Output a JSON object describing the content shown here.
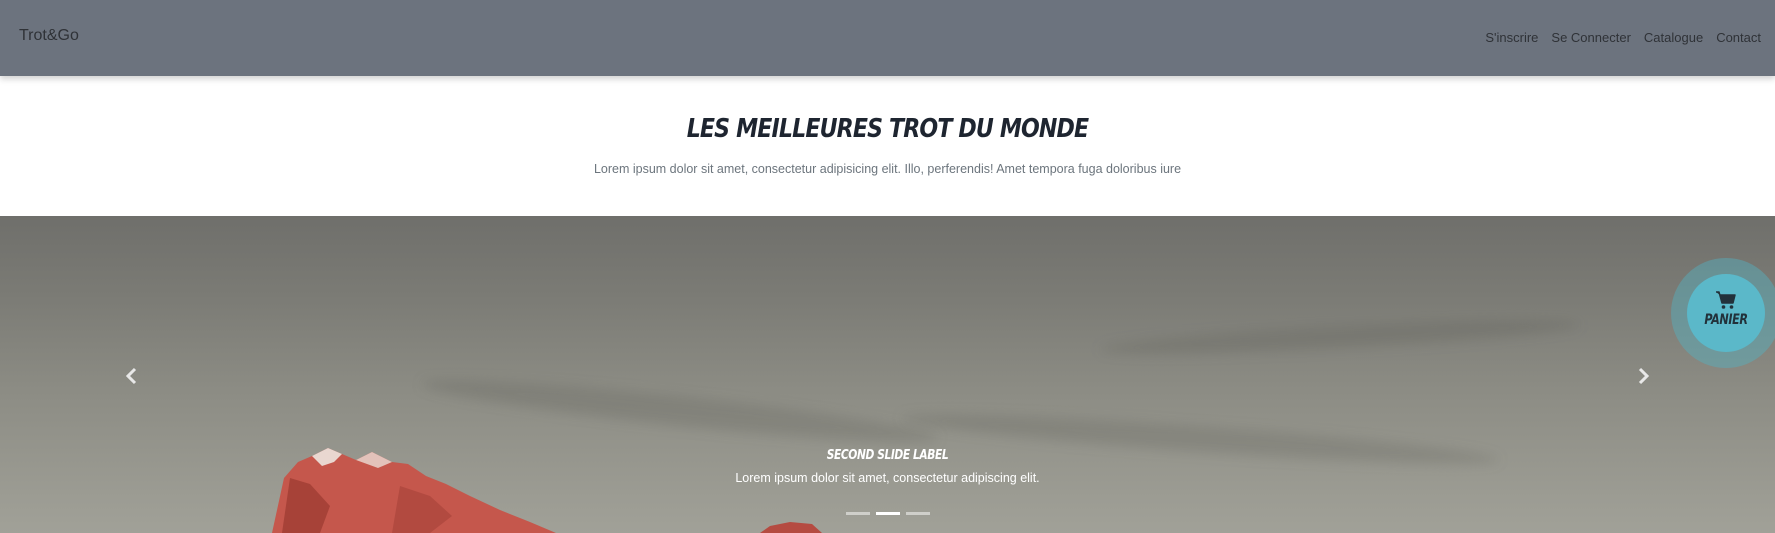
{
  "navbar": {
    "brand": "Trot&Go",
    "links": [
      "S'inscrire",
      "Se Connecter",
      "Catalogue",
      "Contact"
    ]
  },
  "hero": {
    "title": "Les meilleures trot du monde",
    "subtitle": "Lorem ipsum dolor sit amet, consectetur adipisicing elit. Illo, perferendis! Amet tempora fuga doloribus iure"
  },
  "carousel": {
    "caption_title": "Second slide label",
    "caption_text": "Lorem ipsum dolor sit amet, consectetur adipiscing elit.",
    "slide_count": 3,
    "active_slide": 2,
    "prev_icon": "chevron-left-icon",
    "next_icon": "chevron-right-icon"
  },
  "cart": {
    "label": "Panier",
    "icon": "shopping-cart-icon"
  },
  "colors": {
    "navbar_bg": "#6c737e",
    "cart_bg": "#5bb8c9",
    "title_color": "#1e2530",
    "subtitle_color": "#6c757d",
    "mountain_red": "#c5574c"
  }
}
